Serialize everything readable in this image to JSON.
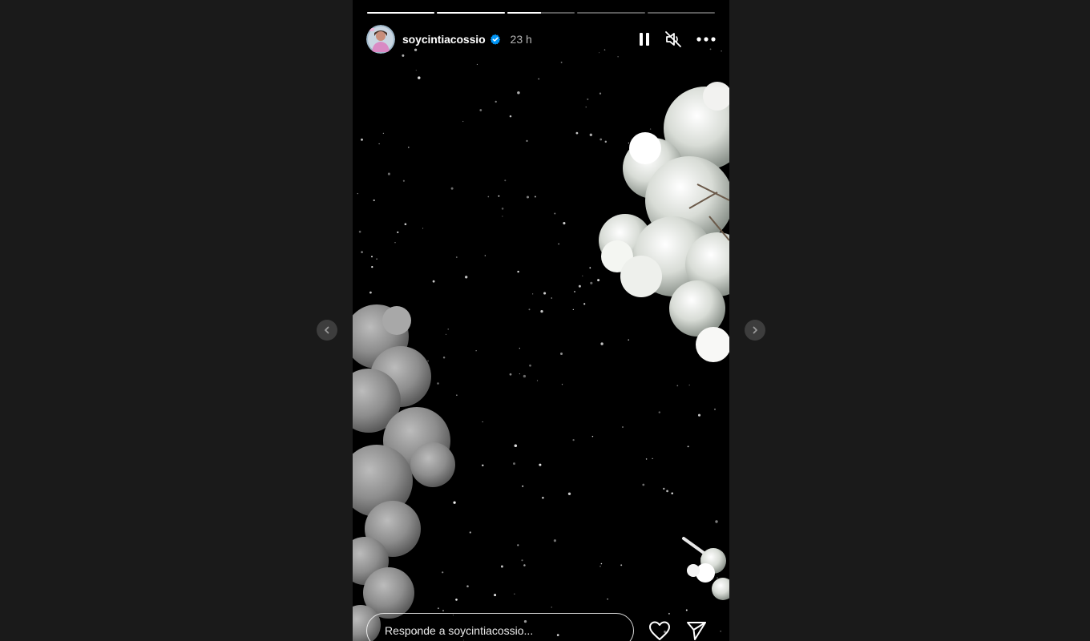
{
  "story": {
    "username": "soycintiacossio",
    "verified": true,
    "timestamp": "23 h",
    "progress": [
      1,
      1,
      0.5,
      0,
      0
    ],
    "reply_placeholder": "Responde a soycintiacossio..."
  },
  "icons": {
    "pause": "pause-icon",
    "mute": "speaker-muted-icon",
    "more": "more-options-icon",
    "like": "heart-outline-icon",
    "share": "paper-plane-icon",
    "previous": "chevron-left-icon",
    "next": "chevron-right-icon",
    "verified": "verified-badge-icon"
  },
  "colors": {
    "page_background": "#1a1a1a",
    "story_background": "#000000",
    "verified_badge": "#0095f6",
    "nav_button": "#3d3d3d"
  }
}
